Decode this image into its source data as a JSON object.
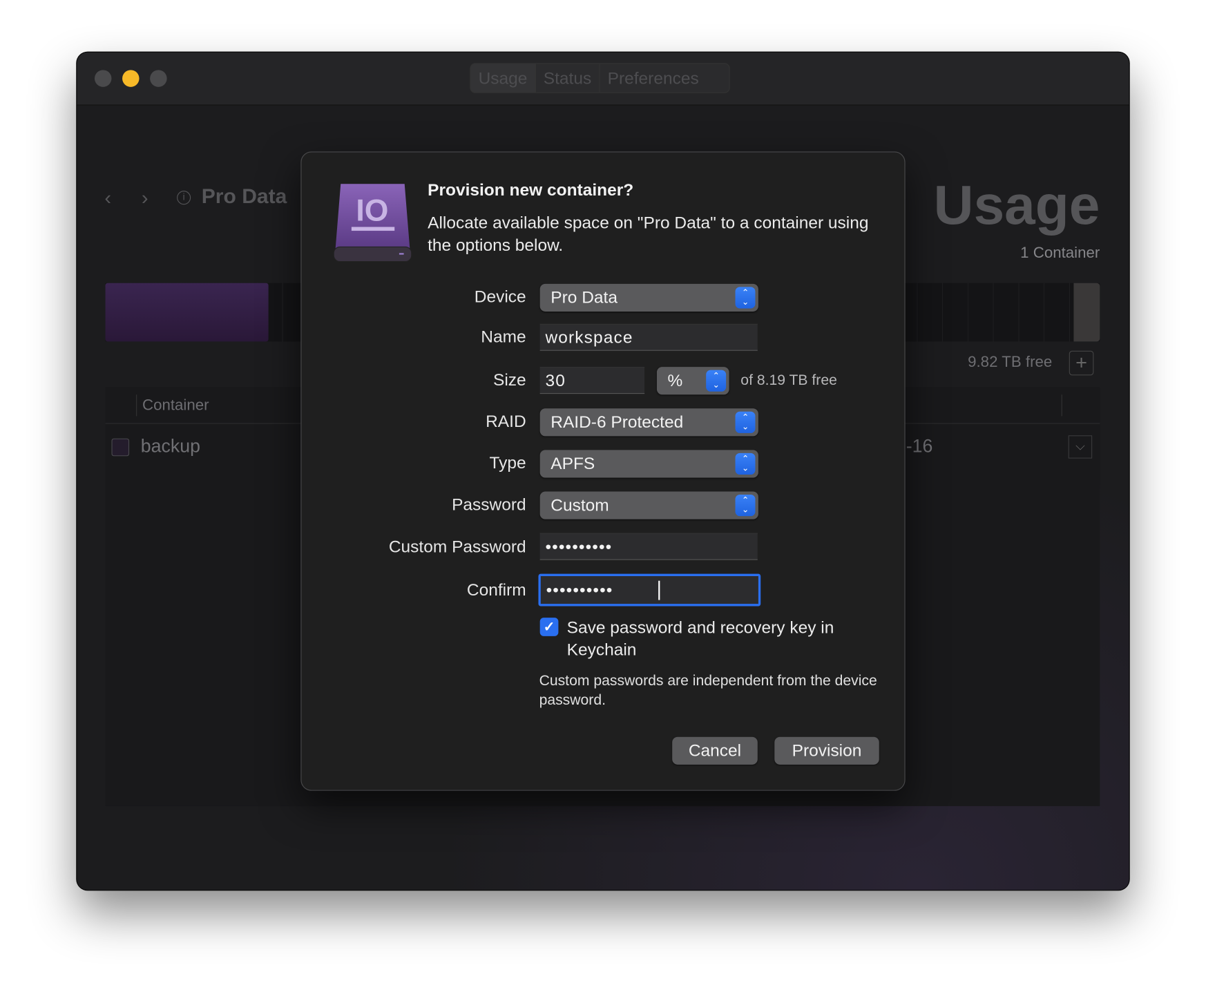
{
  "window": {
    "tabs": [
      "Usage",
      "Status",
      "Preferences"
    ],
    "traffic_light_colors": [
      "#4a4a4c",
      "#f7b928",
      "#4a4a4c"
    ]
  },
  "background": {
    "title": "Usage",
    "container_count": "1 Container",
    "device_name": "Pro Data",
    "free_space": "9.82 TB free",
    "table_header": "Container",
    "rows": [
      {
        "name": "backup",
        "trailing": "-16"
      }
    ]
  },
  "dialog": {
    "icon": "io-drive-icon",
    "icon_text": "IO",
    "title": "Provision new container?",
    "description": "Allocate available space on \"Pro Data\" to a container using the options below.",
    "device": {
      "label": "Device",
      "value": "Pro Data"
    },
    "name": {
      "label": "Name",
      "value": "workspace"
    },
    "size": {
      "label": "Size",
      "value": "30",
      "unit": "%",
      "suffix": "of 8.19 TB free"
    },
    "raid": {
      "label": "RAID",
      "value": "RAID-6 Protected"
    },
    "type": {
      "label": "Type",
      "value": "APFS"
    },
    "password": {
      "label": "Password",
      "value": "Custom"
    },
    "custom_password": {
      "label": "Custom Password",
      "value": "••••••••••"
    },
    "confirm": {
      "label": "Confirm",
      "value": "••••••••••"
    },
    "keychain": {
      "label": "Save password and recovery key in Keychain",
      "checked": true
    },
    "note": "Custom passwords are independent from the device password.",
    "cancel_label": "Cancel",
    "provision_label": "Provision",
    "accent_color": "#2a6ff0"
  }
}
